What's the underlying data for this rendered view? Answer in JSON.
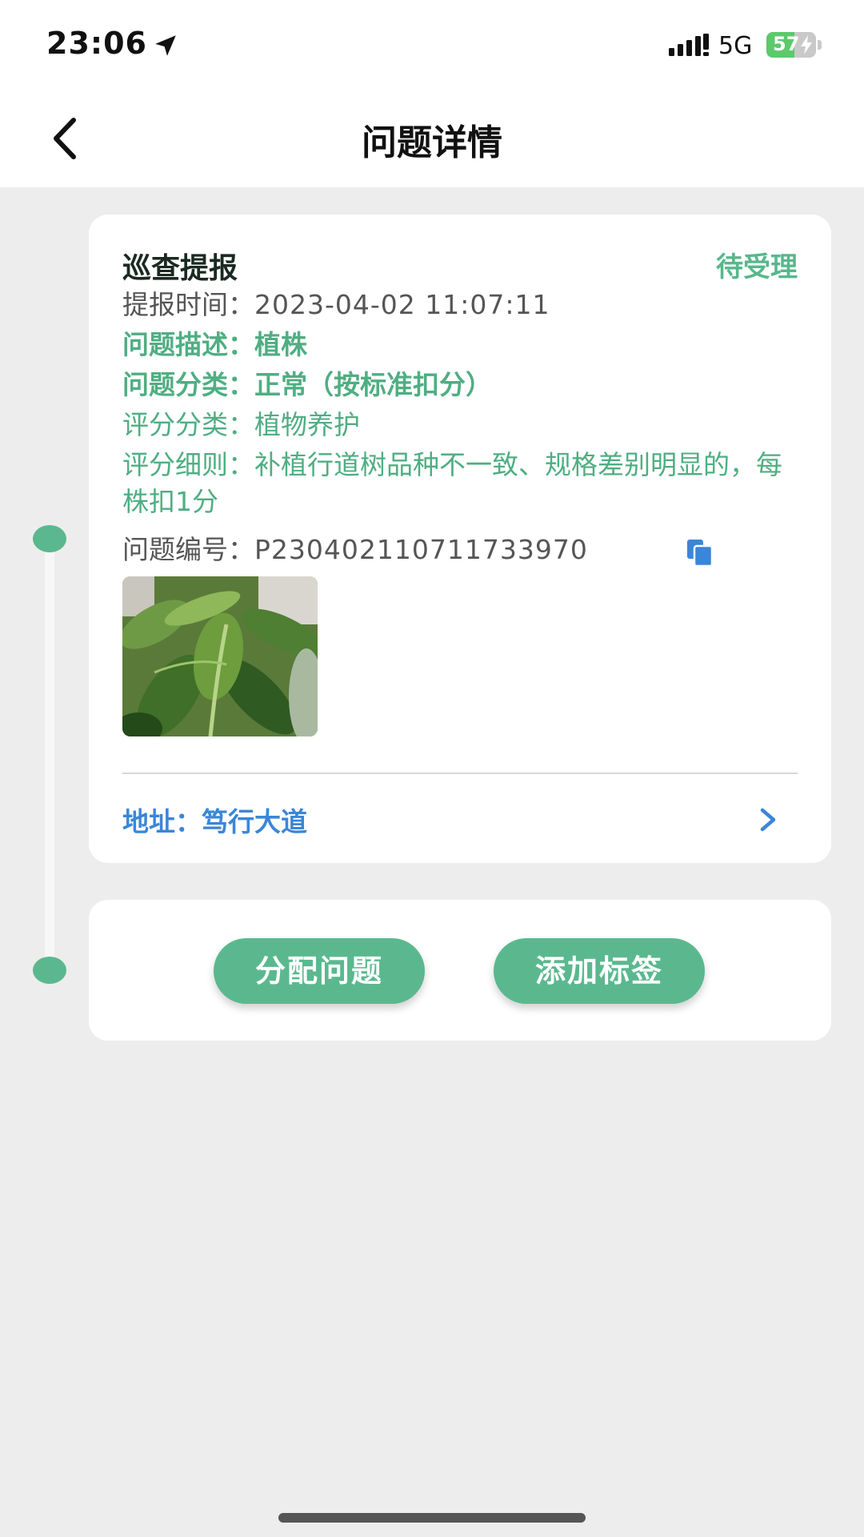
{
  "status_bar": {
    "time": "23:06",
    "network": "5G",
    "battery_percent": "57",
    "battery_level": 0.57,
    "icons": [
      "location-arrow-icon",
      "signal-icon",
      "battery-icon",
      "charging-bolt-icon"
    ]
  },
  "header": {
    "title": "问题详情",
    "back_icon": "chevron-left-icon"
  },
  "report": {
    "title": "巡查提报",
    "status": "待受理",
    "report_time_label": "提报时间：",
    "report_time": "2023-04-02 11:07:11",
    "description_label": "问题描述：",
    "description": "植株",
    "category_label": "问题分类：",
    "category": "正常（按标准扣分）",
    "score_category_label": "评分分类：",
    "score_category": "植物养护",
    "score_rule_label": "评分细则：",
    "score_rule": "补植行道树品种不一致、规格差别明显的，每株扣1分",
    "issue_no_label": "问题编号：",
    "issue_no": "P230402110711733970",
    "copy_icon": "copy-icon",
    "photo": "plant-photo",
    "address_label": "地址：",
    "address": "笃行大道",
    "address_icon": "chevron-right-icon"
  },
  "actions": {
    "assign_label": "分配问题",
    "add_tag_label": "添加标签"
  },
  "colors": {
    "accent_green": "#5bb88e",
    "text_green": "#4fae82",
    "link_blue": "#3a86d8",
    "background": "#ededed"
  }
}
